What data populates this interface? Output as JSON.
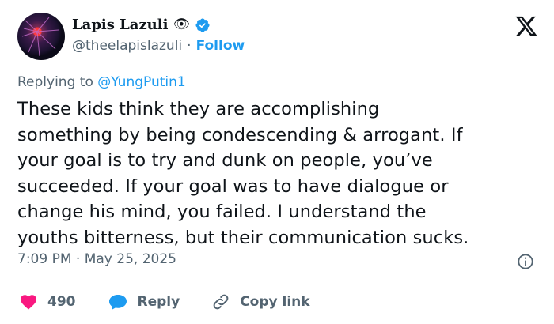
{
  "user": {
    "display_name": "Lapis Lazuli",
    "name_emoji": "👁",
    "handle": "@theelapislazuli",
    "separator": "·",
    "follow_label": "Follow",
    "verified_icon": "verified-badge-icon",
    "avatar_icon": "plasma-ball-avatar"
  },
  "tweet": {
    "replying_prefix": "Replying to",
    "replying_to": "@YungPutin1",
    "text": "These kids think they are accomplishing\nsomething by being condescending & arrogant. If\nyour goal is to try and dunk on people, you’ve\nsucceeded. If your goal was to have dialogue or\nchange his mind, you failed. I understand the\nyouths bitterness, but their communication sucks.",
    "timestamp": "7:09 PM · May 25, 2025"
  },
  "actions": {
    "like_count": "490",
    "reply_label": "Reply",
    "copy_link_label": "Copy link"
  },
  "colors": {
    "accent": "#1d9bf0",
    "like": "#f91880",
    "muted": "#536471",
    "text": "#0f1419",
    "divider": "#cfd9de"
  },
  "icons": [
    "x-logo-icon",
    "info-icon",
    "heart-icon",
    "reply-bubble-icon",
    "link-icon",
    "eye-icon"
  ]
}
